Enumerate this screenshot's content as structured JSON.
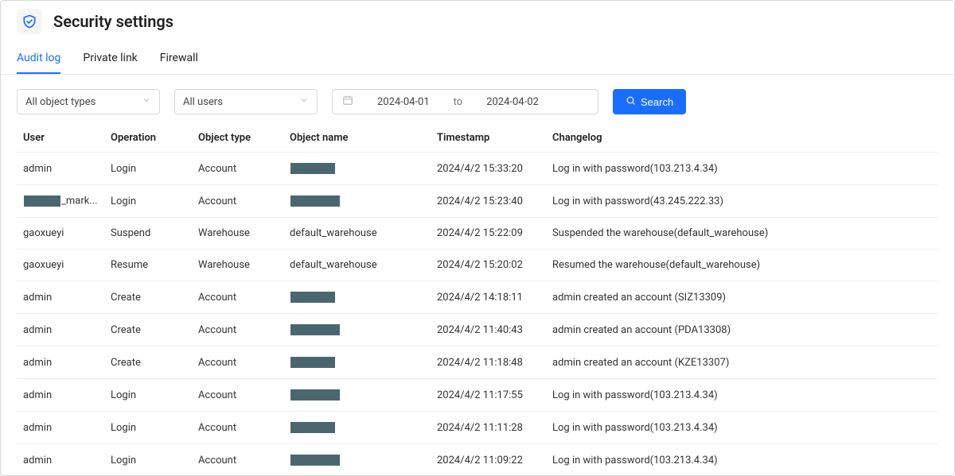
{
  "header": {
    "title": "Security settings"
  },
  "tabs": [
    {
      "label": "Audit log",
      "active": true
    },
    {
      "label": "Private link",
      "active": false
    },
    {
      "label": "Firewall",
      "active": false
    }
  ],
  "filters": {
    "object_type_select": {
      "selected": "All object types"
    },
    "user_select": {
      "selected": "All users"
    },
    "date_range": {
      "start": "2024-04-01",
      "end": "2024-04-02",
      "separator": "to"
    },
    "search_label": "Search"
  },
  "columns": [
    "User",
    "Operation",
    "Object type",
    "Object name",
    "Timestamp",
    "Changelog"
  ],
  "rows": [
    {
      "user": "admin",
      "user_redact": false,
      "user_suffix": "",
      "operation": "Login",
      "object_type": "Account",
      "object_name_redact": true,
      "object_name": "",
      "timestamp": "2024/4/2 15:33:20",
      "changelog": "Log in with password(103.213.4.34)"
    },
    {
      "user": "",
      "user_redact": true,
      "user_suffix": "_mark...",
      "operation": "Login",
      "object_type": "Account",
      "object_name_redact": true,
      "object_name": "",
      "timestamp": "2024/4/2 15:23:40",
      "changelog": "Log in with password(43.245.222.33)"
    },
    {
      "user": "gaoxueyi",
      "user_redact": false,
      "user_suffix": "",
      "operation": "Suspend",
      "object_type": "Warehouse",
      "object_name_redact": false,
      "object_name": "default_warehouse",
      "timestamp": "2024/4/2 15:22:09",
      "changelog": "Suspended the warehouse(default_warehouse)"
    },
    {
      "user": "gaoxueyi",
      "user_redact": false,
      "user_suffix": "",
      "operation": "Resume",
      "object_type": "Warehouse",
      "object_name_redact": false,
      "object_name": "default_warehouse",
      "timestamp": "2024/4/2 15:20:02",
      "changelog": "Resumed the warehouse(default_warehouse)"
    },
    {
      "user": "admin",
      "user_redact": false,
      "user_suffix": "",
      "operation": "Create",
      "object_type": "Account",
      "object_name_redact": true,
      "object_name": "",
      "timestamp": "2024/4/2 14:18:11",
      "changelog": "admin created an account (SIZ13309)"
    },
    {
      "user": "admin",
      "user_redact": false,
      "user_suffix": "",
      "operation": "Create",
      "object_type": "Account",
      "object_name_redact": true,
      "object_name": "",
      "timestamp": "2024/4/2 11:40:43",
      "changelog": "admin created an account (PDA13308)"
    },
    {
      "user": "admin",
      "user_redact": false,
      "user_suffix": "",
      "operation": "Create",
      "object_type": "Account",
      "object_name_redact": true,
      "object_name": "",
      "timestamp": "2024/4/2 11:18:48",
      "changelog": "admin created an account (KZE13307)"
    },
    {
      "user": "admin",
      "user_redact": false,
      "user_suffix": "",
      "operation": "Login",
      "object_type": "Account",
      "object_name_redact": true,
      "object_name": "",
      "timestamp": "2024/4/2 11:17:55",
      "changelog": "Log in with password(103.213.4.34)"
    },
    {
      "user": "admin",
      "user_redact": false,
      "user_suffix": "",
      "operation": "Login",
      "object_type": "Account",
      "object_name_redact": true,
      "object_name": "",
      "timestamp": "2024/4/2 11:11:28",
      "changelog": "Log in with password(103.213.4.34)"
    },
    {
      "user": "admin",
      "user_redact": false,
      "user_suffix": "",
      "operation": "Login",
      "object_type": "Account",
      "object_name_redact": true,
      "object_name": "",
      "timestamp": "2024/4/2 11:09:22",
      "changelog": "Log in with password(103.213.4.34)"
    }
  ]
}
